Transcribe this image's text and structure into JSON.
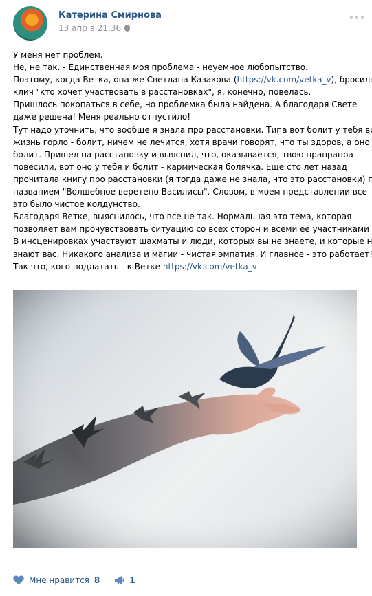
{
  "post": {
    "author": "Катерина Смирнова",
    "date": "13 апр в 21:36",
    "text_lines": [
      {
        "text": "У меня нет проблем."
      },
      {
        "text": "Не, не так. - Единственная моя проблема - неуемное любопытство."
      },
      {
        "pre": "Поэтому, когда Ветка, она же Светлана Казакова (",
        "link": "https://vk.com/vetka_v",
        "post": "), бросила"
      },
      {
        "text": "клич \"кто хочет участвовать в расстановках\", я, конечно, повелась."
      },
      {
        "text": "Пришлось покопаться в себе, но проблемка была найдена. А благодаря Свете"
      },
      {
        "text": "даже решена! Меня реально отпустило!"
      },
      {
        "text": "Тут надо уточнить, что вообще я знала про расстановки. Типа вот болит у тебя всю"
      },
      {
        "text": "жизнь горло - болит, ничем не лечится, хотя врачи говорят, что ты здоров, а оно"
      },
      {
        "text": "болит. Пришел на расстановку и выяснил, что, оказывается, твою прапрапра"
      },
      {
        "text": "повесили, вот оно у тебя и болит - кармическая болячка. Еще сто лет назад"
      },
      {
        "text": "прочитала книгу про расстановки (я тогда даже не знала, что это расстановки) под"
      },
      {
        "text": "названием \"Волшебное веретено Василисы\". Словом, в моем представлении все"
      },
      {
        "text": "это было чистое колдунство."
      },
      {
        "text": "Благодаря Ветке, выяснилось, что все не так. Нормальная это тема, которая"
      },
      {
        "text": "позволяет вам прочувствовать ситуацию со всех сторон и всеми ее участниками"
      },
      {
        "text": "В инсценировках участвуют шахматы и люди, которых вы не знаете, и которые не"
      },
      {
        "text": "знают вас. Никакого анализа и магии - чистая эмпатия. И главное - это работает!"
      },
      {
        "pre": "Так что, кого подлатать - к Ветке ",
        "link": "https://vk.com/vetka_v",
        "post": ""
      }
    ]
  },
  "actions": {
    "like_label": "Мне нравится",
    "like_count": "8",
    "repost_count": "1"
  },
  "icons": {
    "more": "more-dots-icon",
    "like": "heart-icon",
    "repost": "megaphone-icon",
    "platform": "apple-icon"
  },
  "colors": {
    "link": "#2a5885",
    "meta": "#939393",
    "icon": "#5b88bd"
  }
}
